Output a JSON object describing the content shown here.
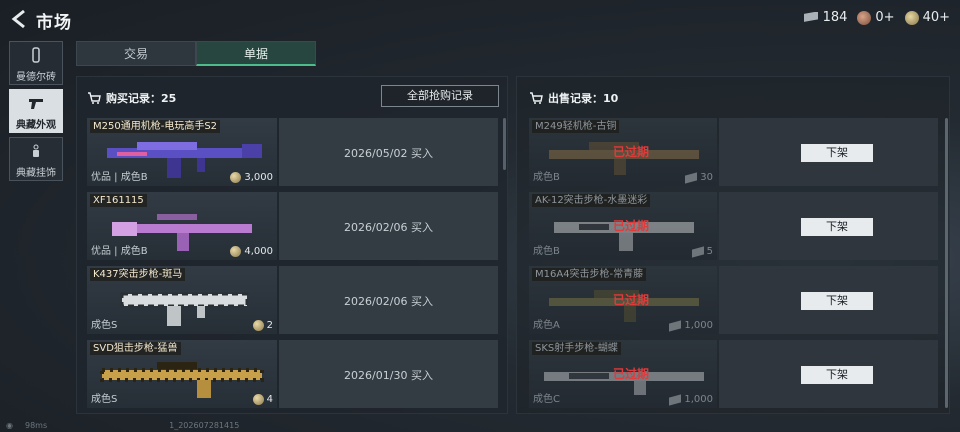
{
  "header": {
    "title": "市场"
  },
  "currencies": [
    {
      "icon": "ticket-icon",
      "value": "184"
    },
    {
      "icon": "medal-icon",
      "value": "0+"
    },
    {
      "icon": "coin-icon",
      "value": "40+"
    }
  ],
  "sidebar": {
    "items": [
      {
        "label": "曼德尔砖",
        "icon": "brick-icon"
      },
      {
        "label": "典藏外观",
        "icon": "pistol-icon"
      },
      {
        "label": "典藏挂饰",
        "icon": "charm-icon"
      }
    ]
  },
  "tabs": [
    {
      "label": "交易"
    },
    {
      "label": "单据"
    }
  ],
  "purchase": {
    "title": "购买记录：25",
    "all_button": "全部抢购记录",
    "items": [
      {
        "name": "M250通用机枪-电玩高手S2",
        "grade": "优品 | 成色B",
        "price": "3,000",
        "date": "2026/05/02  买入"
      },
      {
        "name": "XF161115",
        "grade": "优品 | 成色B",
        "price": "4,000",
        "date": "2026/02/06  买入"
      },
      {
        "name": "K437突击步枪-斑马",
        "grade": "成色S",
        "price": "2",
        "date": "2026/02/06  买入"
      },
      {
        "name": "SVD狙击步枪-猛兽",
        "grade": "成色S",
        "price": "4",
        "date": "2026/01/30  买入"
      }
    ]
  },
  "sales": {
    "title": "出售记录：10",
    "items": [
      {
        "name": "M249轻机枪-古铜",
        "grade": "成色B",
        "price": "30",
        "status": "已过期",
        "action": "下架"
      },
      {
        "name": "AK-12突击步枪-水墨迷彩",
        "grade": "成色B",
        "price": "5",
        "status": "已过期",
        "action": "下架"
      },
      {
        "name": "M16A4突击步枪-常青藤",
        "grade": "成色A",
        "price": "1,000",
        "status": "已过期",
        "action": "下架"
      },
      {
        "name": "SKS射手步枪-蝴蝶",
        "grade": "成色C",
        "price": "1,000",
        "status": "已过期",
        "action": "下架"
      }
    ]
  },
  "footer": {
    "ping": "98ms",
    "uid": "1_202607281415"
  },
  "colors": {
    "accent": "#4dbb8c",
    "expired": "#e23a3a",
    "active_side": "#d9dfe3"
  }
}
